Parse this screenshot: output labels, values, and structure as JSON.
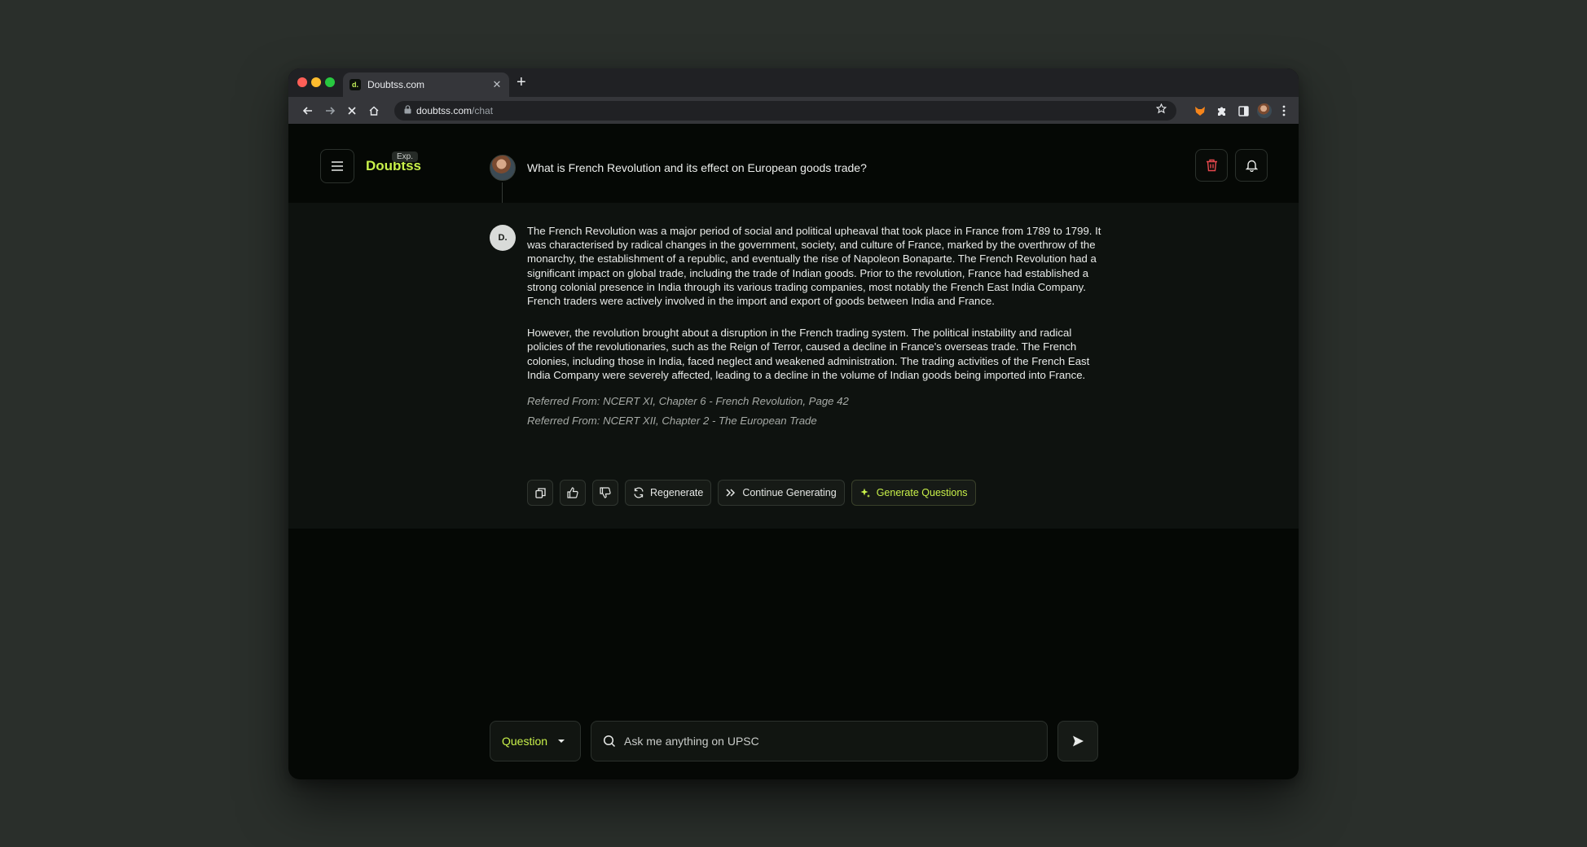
{
  "browser": {
    "tab_title": "Doubtss.com",
    "favicon_text": "d.",
    "url_host": "doubtss.com",
    "url_path": "/chat"
  },
  "header": {
    "brand": "Doubtss",
    "badge": "Exp.",
    "question": "What is French Revolution and its effect on European goods trade?"
  },
  "answer": {
    "bot_avatar": "D.",
    "paragraphs": [
      "The French Revolution was a major period of social and political upheaval that took place in France from 1789 to 1799. It was characterised by radical changes in the government, society, and culture of France, marked by the overthrow of the monarchy, the establishment of a republic, and eventually the rise of Napoleon Bonaparte. The French Revolution had a significant impact on global trade, including the trade of Indian goods. Prior to the revolution, France had established a strong colonial presence in India through its various trading companies, most notably the French East India Company. French traders were actively involved in the import and export of goods between India and France.",
      "However, the revolution brought about a disruption in the French trading system. The political instability and radical policies of the revolutionaries, such as the Reign of Terror, caused a decline in France's overseas trade. The French colonies, including those in India, faced neglect and weakened administration. The trading activities of the French East India Company were severely affected, leading to a decline in the volume of Indian goods being imported into France."
    ],
    "references": [
      "Referred From: NCERT XI, Chapter 6 - French Revolution, Page 42",
      "Referred From: NCERT XII, Chapter 2 - The European Trade"
    ]
  },
  "actions": {
    "regenerate": "Regenerate",
    "continue": "Continue Generating",
    "generate_questions": "Generate Questions"
  },
  "composer": {
    "mode": "Question",
    "placeholder": "Ask me anything on UPSC"
  },
  "colors": {
    "accent": "#c8f04a",
    "danger": "#e5484d",
    "background": "#050805",
    "panel": "#0e120f"
  }
}
